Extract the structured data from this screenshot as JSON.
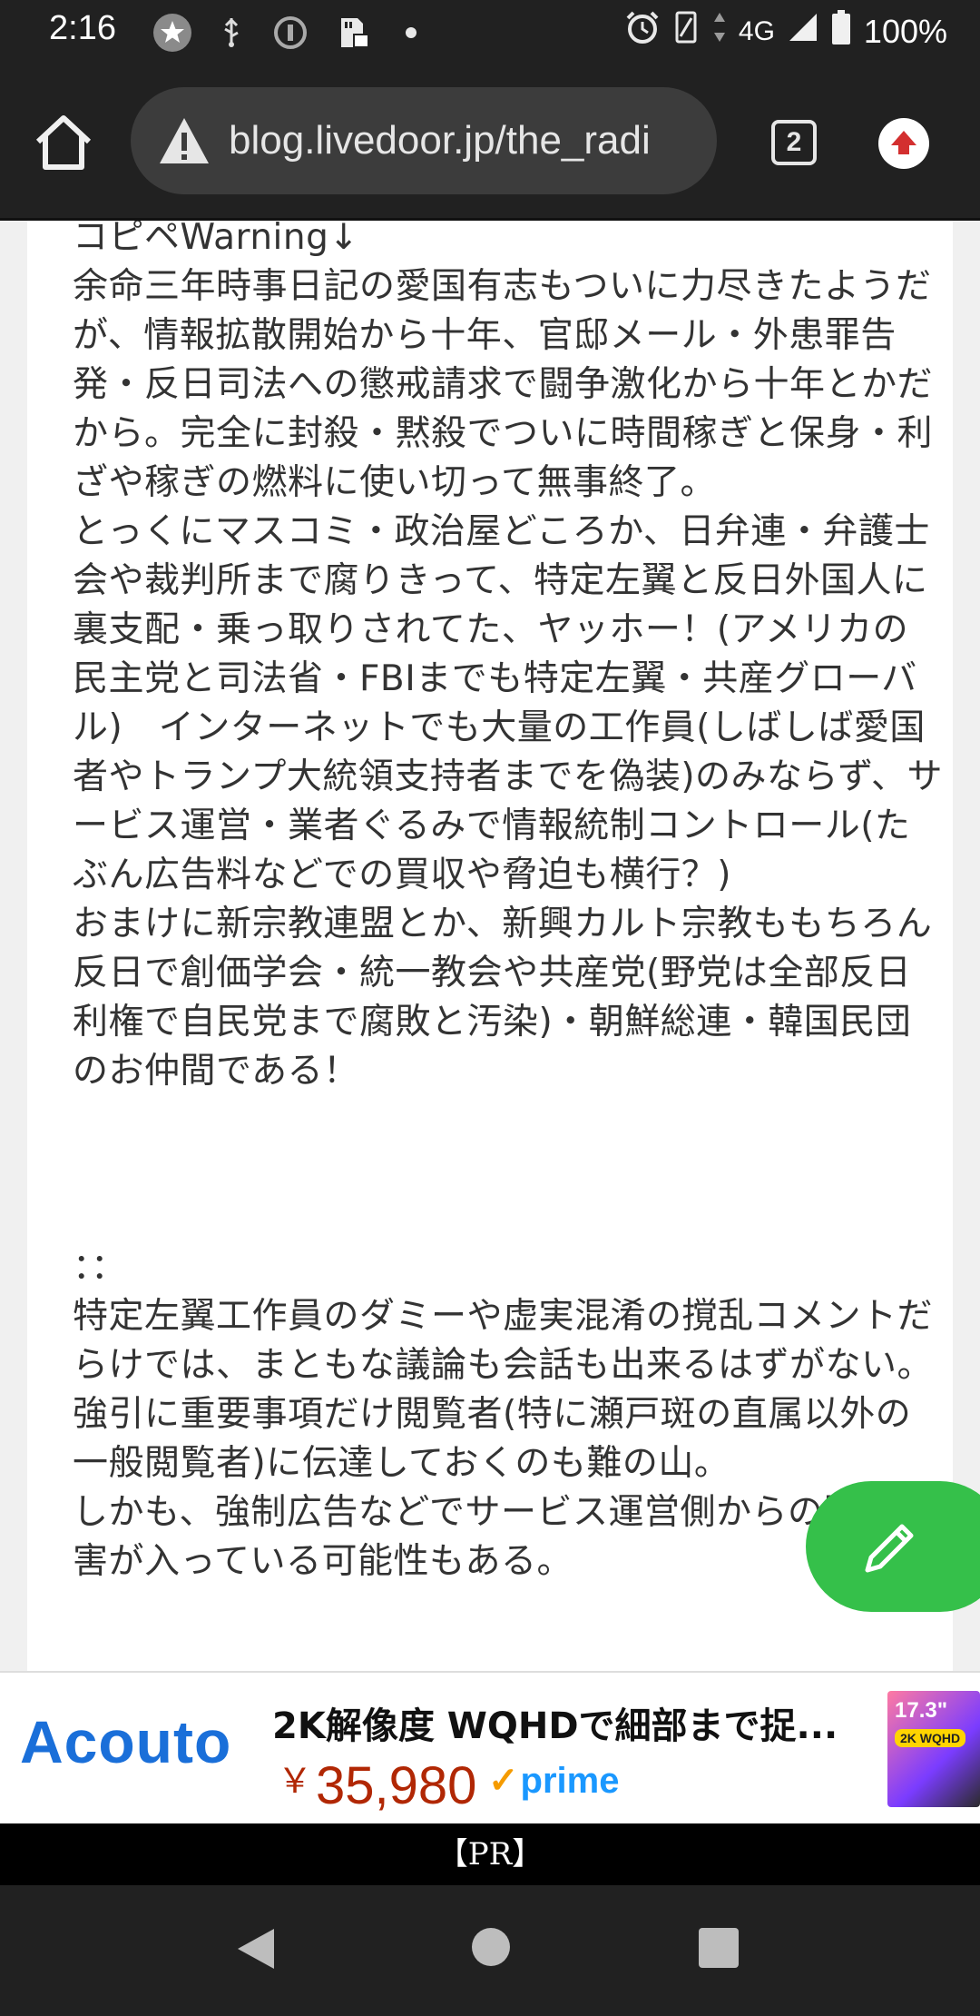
{
  "status_bar": {
    "time": "2:16",
    "network": "4G",
    "battery": "100%",
    "icons": [
      "star-badge-icon",
      "usb-icon",
      "info-icon",
      "sd-lock-icon",
      "dot-icon",
      "alarm-icon",
      "vibrate-icon",
      "data-arrows-icon",
      "signal-icon",
      "battery-icon"
    ]
  },
  "browser": {
    "url": "blog.livedoor.jp/the_radi",
    "tab_count": "2"
  },
  "article": {
    "paragraphs": [
      "コピペWarning↓",
      "余命三年時事日記の愛国有志もついに力尽きたようだが、情報拡散開始から十年、官邸メール・外患罪告発・反日司法への懲戒請求で闘争激化から十年とかだから。完全に封殺・黙殺でついに時間稼ぎと保身・利ざや稼ぎの燃料に使い切って無事終了。",
      "とっくにマスコミ・政治屋どころか、日弁連・弁護士会や裁判所まで腐りきって、特定左翼と反日外国人に裏支配・乗っ取りされてた、ヤッホー！(アメリカの民主党と司法省・FBIまでも特定左翼・共産グローバル)　インターネットでも大量の工作員(しばしば愛国者やトランプ大統領支持者までを偽装)のみならず、サービス運営・業者ぐるみで情報統制コントロール(たぶん広告料などでの買収や脅迫も横行？)",
      "おまけに新宗教連盟とか、新興カルト宗教ももちろん反日で創価学会・統一教会や共産党(野党は全部反日利権で自民党まで腐敗と汚染)・朝鮮総連・韓国民団のお仲間である！",
      "：：",
      "特定左翼工作員のダミーや虚実混淆の撹乱コメントだらけでは、まともな議論も会話も出来るはずがない。強引に重要事項だけ閲覧者(特に瀬戸斑の直属以外の一般閲覧者)に伝達しておくのも難の山。",
      "しかも、強制広告などでサービス運営側からの閲覧妨害が入っている可能性もある。"
    ]
  },
  "fab": {
    "icon": "pencil-icon"
  },
  "ad": {
    "brand": "Acouto",
    "title": "2K解像度 WQHDで細部まで捉...",
    "price_symbol": "￥",
    "price": "35,980",
    "prime": "prime",
    "image_badge": "17.3\"",
    "image_tag": "2K WQHD"
  },
  "pr_label": "【PR】"
}
